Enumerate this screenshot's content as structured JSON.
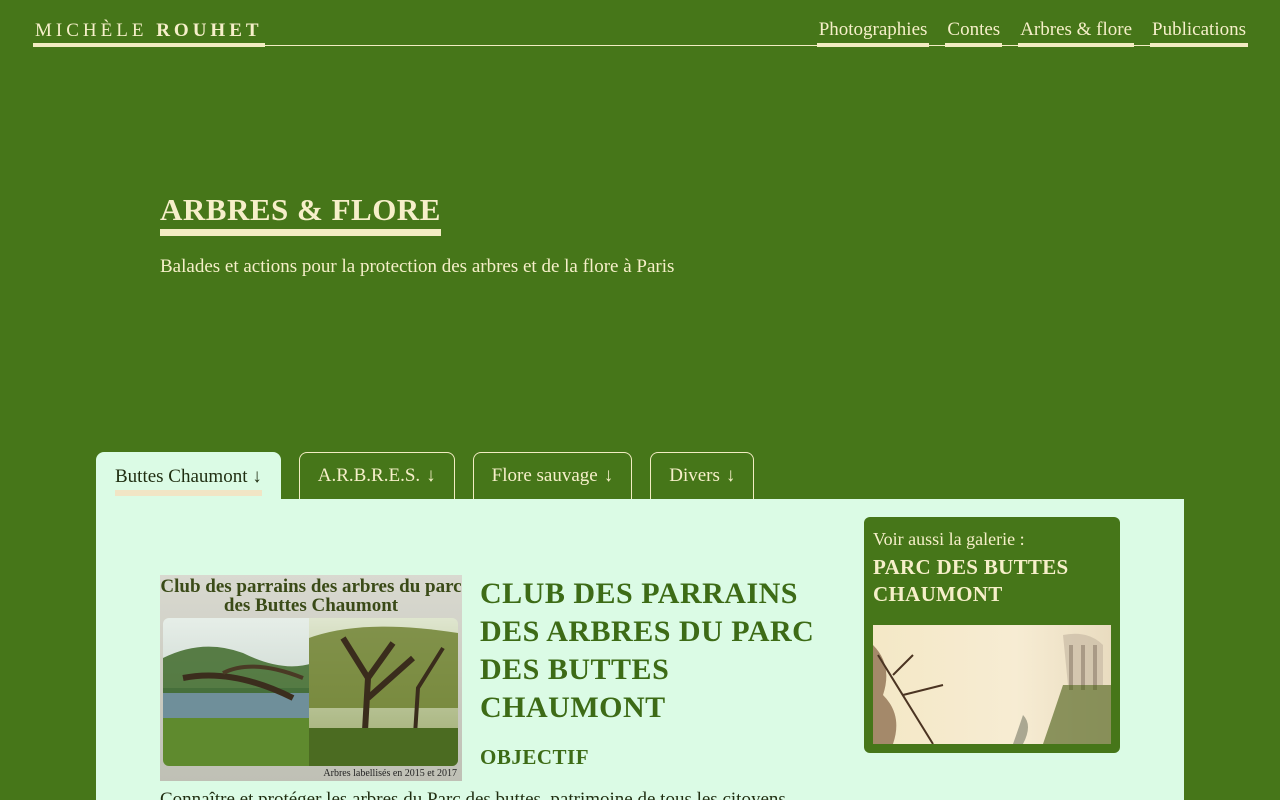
{
  "header": {
    "brand_first": "MICHÈLE",
    "brand_last": "ROUHET",
    "nav": [
      "Photographies",
      "Contes",
      "Arbres & flore",
      "Publications"
    ]
  },
  "hero": {
    "title": "ARBRES & FLORE",
    "subtitle": "Balades et actions pour la protection des arbres et de la flore à Paris"
  },
  "tabs": [
    {
      "label": "Buttes Chaumont",
      "arrow": "↓"
    },
    {
      "label": "A.R.B.R.E.S.",
      "arrow": "↓"
    },
    {
      "label": "Flore sauvage",
      "arrow": "↓"
    },
    {
      "label": "Divers",
      "arrow": "↓"
    }
  ],
  "article": {
    "image_title": "Club des parrains des arbres du parc des Buttes Chaumont",
    "image_caption": "Arbres labellisés en 2015 et 2017",
    "title": "CLUB DES PARRAINS DES ARBRES DU PARC DES BUTTES CHAUMONT",
    "section": "OBJECTIF",
    "body": "Connaître et protéger les arbres du Parc des buttes, patrimoine de tous les citoyens"
  },
  "gallery": {
    "intro": "Voir aussi la galerie :",
    "title": "PARC DES BUTTES CHAUMONT"
  },
  "colors": {
    "background": "#467619",
    "panel": "#dbfbe5",
    "cream": "#f6efc9",
    "heading_green": "#3d6b16"
  }
}
